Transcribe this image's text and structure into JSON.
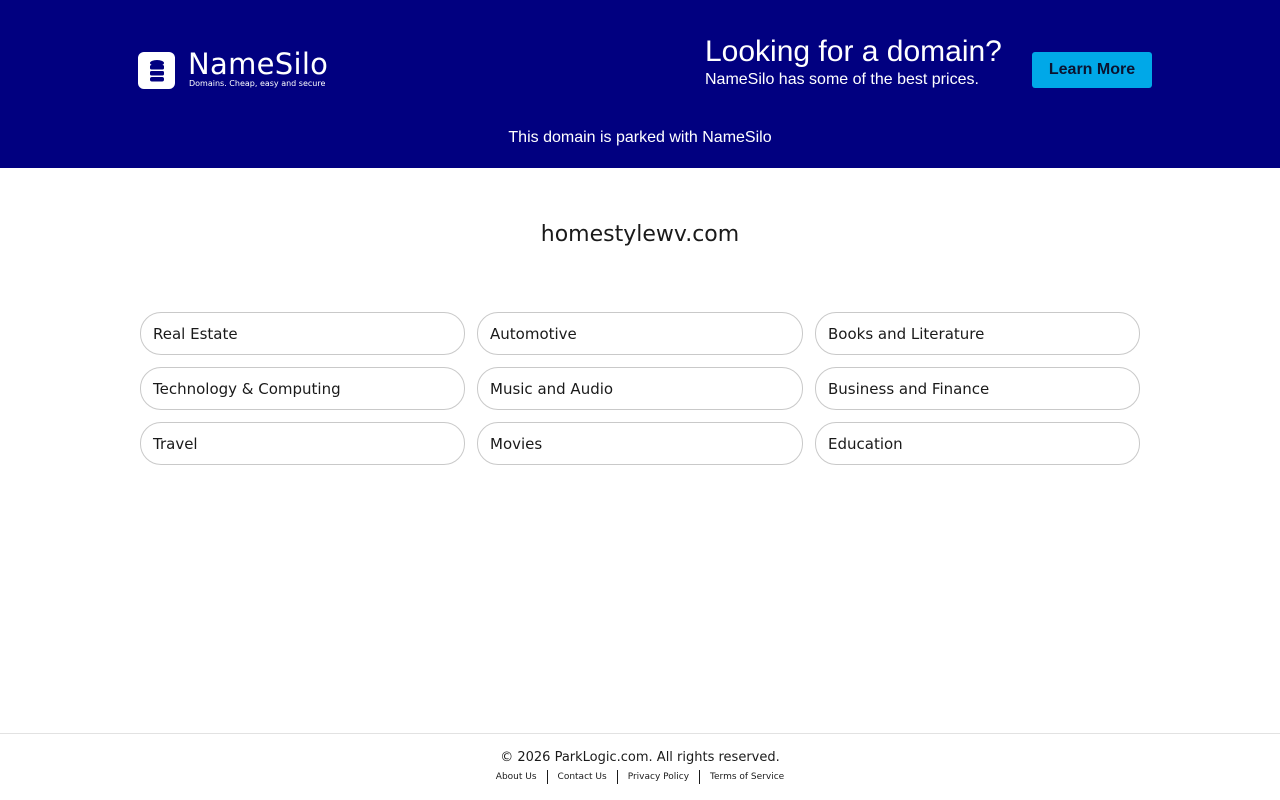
{
  "banner": {
    "logo": {
      "name": "NameSilo",
      "tagline": "Domains. Cheap, easy and secure",
      "icon": "database-icon"
    },
    "promo_heading": "Looking for a domain?",
    "promo_subtext": "NameSilo has some of the best prices.",
    "learn_more_label": "Learn More",
    "parked_note": "This domain is parked with NameSilo",
    "colors": {
      "background": "#010080",
      "button": "#00a8e8"
    }
  },
  "main": {
    "domain_name": "homestylewv.com",
    "categories": [
      "Real Estate",
      "Automotive",
      "Books and Literature",
      "Technology & Computing",
      "Music and Audio",
      "Business and Finance",
      "Travel",
      "Movies",
      "Education"
    ]
  },
  "footer": {
    "copyright": "© 2026 ParkLogic.com. All rights reserved.",
    "links": [
      "About Us",
      "Contact Us",
      "Privacy Policy",
      "Terms of Service"
    ]
  }
}
